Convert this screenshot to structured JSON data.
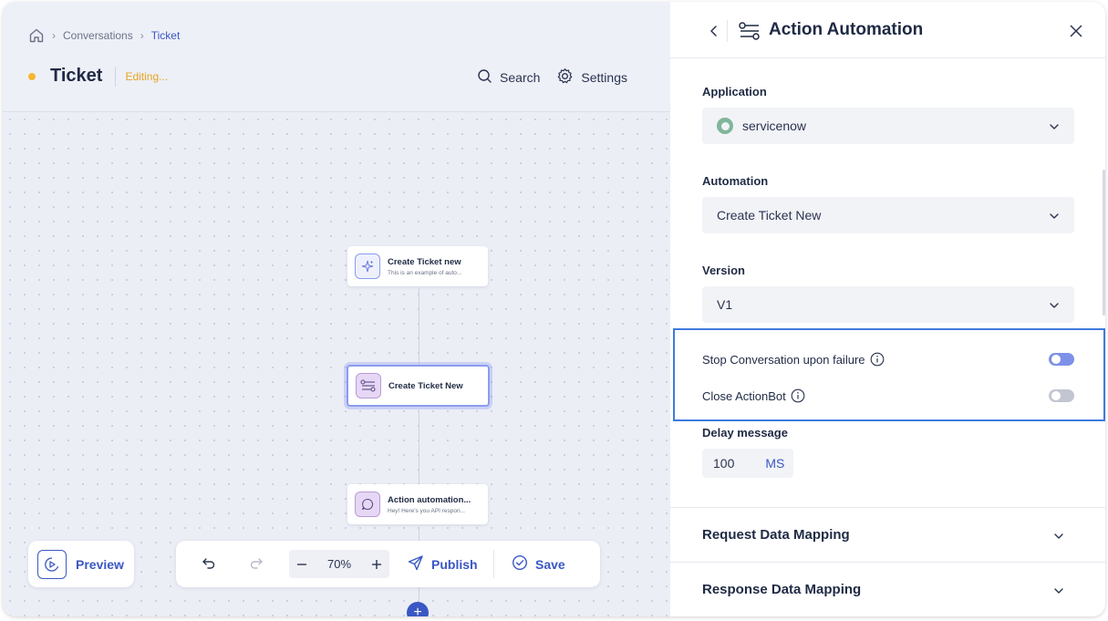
{
  "breadcrumb": {
    "items": [
      "Conversations",
      "Ticket"
    ]
  },
  "header": {
    "title": "Ticket",
    "status": "Editing...",
    "search_label": "Search",
    "settings_label": "Settings"
  },
  "flow": {
    "nodes": [
      {
        "title": "Create Ticket new",
        "subtitle": "This is an example of auto..."
      },
      {
        "title": "Create Ticket New",
        "subtitle": ""
      },
      {
        "title": "Action automation...",
        "subtitle": "Hey! Here's you API respon..."
      }
    ]
  },
  "toolbar": {
    "preview_label": "Preview",
    "zoom": "70%",
    "publish_label": "Publish",
    "save_label": "Save",
    "add_label": "+"
  },
  "panel": {
    "title": "Action Automation",
    "application": {
      "label": "Application",
      "value": "servicenow"
    },
    "automation": {
      "label": "Automation",
      "value": "Create Ticket New"
    },
    "version": {
      "label": "Version",
      "value": "V1"
    },
    "stop_conversation": {
      "label": "Stop Conversation upon failure",
      "enabled": true
    },
    "close_actionbot": {
      "label": "Close ActionBot",
      "enabled": false
    },
    "delay": {
      "label": "Delay message",
      "value": "100",
      "unit": "MS"
    },
    "sections": [
      "Request Data Mapping",
      "Response Data Mapping"
    ]
  },
  "colors": {
    "accent": "#3a57c4",
    "status_dot": "#f5b82e",
    "highlight": "#3d7bde",
    "toggle_on": "#7d91e8"
  },
  "icons": [
    "home-icon",
    "search-icon",
    "gear-icon",
    "sparkle-icon",
    "automation-icon",
    "chat-icon",
    "preview-icon",
    "undo-icon",
    "redo-icon",
    "send-icon",
    "check-circle-icon",
    "chevron-left-icon",
    "close-icon",
    "chevron-down-icon",
    "info-icon"
  ]
}
